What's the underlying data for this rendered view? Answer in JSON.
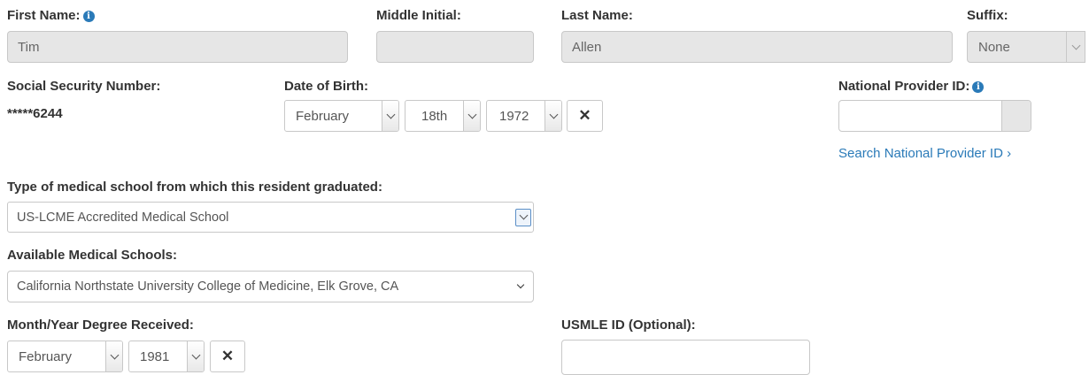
{
  "first_name": {
    "label": "First Name:",
    "value": "Tim"
  },
  "middle_initial": {
    "label": "Middle Initial:",
    "value": ""
  },
  "last_name": {
    "label": "Last Name:",
    "value": "Allen"
  },
  "suffix": {
    "label": "Suffix:",
    "value": "None"
  },
  "ssn": {
    "label": "Social Security Number:",
    "value": "*****6244"
  },
  "dob": {
    "label": "Date of Birth:",
    "month": "February",
    "day": "18th",
    "year": "1972",
    "clear_symbol": "✕"
  },
  "npi": {
    "label": "National Provider ID:",
    "value": "",
    "search_link": "Search National Provider ID ›"
  },
  "school_type": {
    "label": "Type of medical school from which this resident graduated:",
    "value": "US-LCME Accredited Medical School"
  },
  "schools": {
    "label": "Available Medical Schools:",
    "value": "California Northstate University College of Medicine, Elk Grove, CA"
  },
  "degree": {
    "label": "Month/Year Degree Received:",
    "month": "February",
    "year": "1981",
    "clear_symbol": "✕"
  },
  "usmle": {
    "label": "USMLE ID (Optional):",
    "value": ""
  },
  "icons": {
    "info": "info-circle-icon",
    "dropdown": "chevron-down-icon",
    "clear": "close-icon"
  },
  "colors": {
    "accent": "#2a7ab8",
    "readonly_bg": "#e6e6e6",
    "border": "#c8c8c8"
  }
}
